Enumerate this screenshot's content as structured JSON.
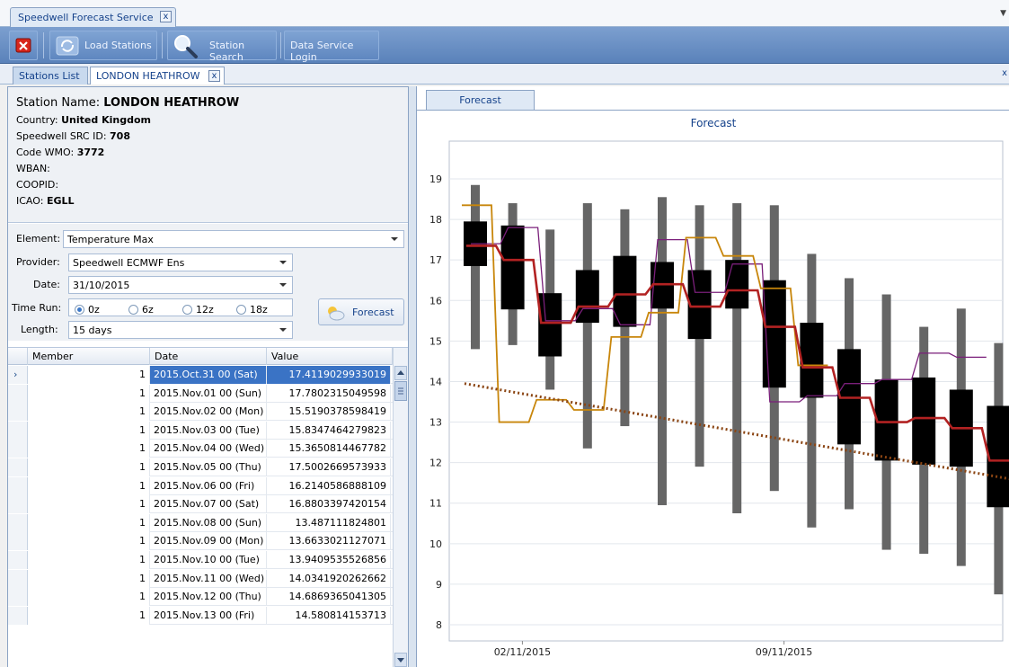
{
  "app": {
    "doc_tab": "Speedwell Forecast Service",
    "close_glyph": "x"
  },
  "toolbar": {
    "load_stations": "Load Stations",
    "station_search": "Station Search",
    "data_service_login": "Data Service Login"
  },
  "tabs": {
    "stations_list": "Stations List",
    "station_tab": "LONDON HEATHROW"
  },
  "station": {
    "name_label": "Station Name:",
    "name": "LONDON HEATHROW",
    "country_label": "Country:",
    "country": "United Kingdom",
    "src_label": "Speedwell SRC ID:",
    "src": "708",
    "wmo_label": "Code WMO:",
    "wmo": "3772",
    "wban_label": "WBAN:",
    "wban": "",
    "coopid_label": "COOPID:",
    "coopid": "",
    "icao_label": "ICAO:",
    "icao": "EGLL"
  },
  "controls": {
    "element_label": "Element:",
    "element_value": "Temperature Max",
    "provider_label": "Provider:",
    "provider_value": "Speedwell ECMWF Ens",
    "date_label": "Date:",
    "date_value": "31/10/2015",
    "time_run_label": "Time Run:",
    "time_runs": [
      "0z",
      "6z",
      "12z",
      "18z"
    ],
    "time_run_selected": "0z",
    "length_label": "Length:",
    "length_value": "15 days",
    "forecast_button": "Forecast"
  },
  "grid": {
    "columns": [
      "Member",
      "Date",
      "Value"
    ],
    "rows": [
      {
        "member": "1",
        "date": "2015.Oct.31 00 (Sat)",
        "value": "17.4119029933019"
      },
      {
        "member": "1",
        "date": "2015.Nov.01 00 (Sun)",
        "value": "17.7802315049598"
      },
      {
        "member": "1",
        "date": "2015.Nov.02 00 (Mon)",
        "value": "15.5190378598419"
      },
      {
        "member": "1",
        "date": "2015.Nov.03 00 (Tue)",
        "value": "15.8347464279823"
      },
      {
        "member": "1",
        "date": "2015.Nov.04 00 (Wed)",
        "value": "15.3650814467782"
      },
      {
        "member": "1",
        "date": "2015.Nov.05 00 (Thu)",
        "value": "17.5002669573933"
      },
      {
        "member": "1",
        "date": "2015.Nov.06 00 (Fri)",
        "value": "16.2140586888109"
      },
      {
        "member": "1",
        "date": "2015.Nov.07 00 (Sat)",
        "value": "16.8803397420154"
      },
      {
        "member": "1",
        "date": "2015.Nov.08 00 (Sun)",
        "value": "13.487111824801"
      },
      {
        "member": "1",
        "date": "2015.Nov.09 00 (Mon)",
        "value": "13.6633021127071"
      },
      {
        "member": "1",
        "date": "2015.Nov.10 00 (Tue)",
        "value": "13.9409535526856"
      },
      {
        "member": "1",
        "date": "2015.Nov.11 00 (Wed)",
        "value": "14.0341920262662"
      },
      {
        "member": "1",
        "date": "2015.Nov.12 00 (Thu)",
        "value": "14.6869365041305"
      },
      {
        "member": "1",
        "date": "2015.Nov.13 00 (Fri)",
        "value": "14.580814153713"
      }
    ]
  },
  "chart_tab": "Forecast",
  "colors": {
    "median": "#b22222",
    "member": "#c8860b",
    "member2": "#7a1f7a",
    "trend": "#8b4513",
    "box": "#000000",
    "whisker": "#666666"
  },
  "chart_data": {
    "type": "box",
    "title": "Forecast",
    "x_tick_labels": [
      "02/11/2015",
      "09/11/2015"
    ],
    "ylim": [
      8,
      19
    ],
    "y_ticks": [
      "8",
      "9",
      "10",
      "11",
      "12",
      "13",
      "14",
      "15",
      "16",
      "17",
      "18",
      "19"
    ],
    "grid": true,
    "boxes": [
      {
        "low": 14.8,
        "q1": 16.85,
        "q3": 17.95,
        "high": 18.85
      },
      {
        "low": 14.9,
        "q1": 15.78,
        "q3": 17.85,
        "high": 18.4
      },
      {
        "low": 13.8,
        "q1": 14.62,
        "q3": 16.18,
        "high": 17.75
      },
      {
        "low": 12.35,
        "q1": 15.45,
        "q3": 16.75,
        "high": 18.4
      },
      {
        "low": 12.9,
        "q1": 15.35,
        "q3": 17.1,
        "high": 18.25
      },
      {
        "low": 10.95,
        "q1": 15.8,
        "q3": 16.95,
        "high": 18.55
      },
      {
        "low": 11.9,
        "q1": 15.05,
        "q3": 16.75,
        "high": 18.35
      },
      {
        "low": 10.75,
        "q1": 15.8,
        "q3": 17.0,
        "high": 18.4
      },
      {
        "low": 11.3,
        "q1": 13.85,
        "q3": 16.5,
        "high": 18.35
      },
      {
        "low": 10.4,
        "q1": 13.6,
        "q3": 15.45,
        "high": 17.15
      },
      {
        "low": 10.85,
        "q1": 12.45,
        "q3": 14.8,
        "high": 16.55
      },
      {
        "low": 9.85,
        "q1": 12.05,
        "q3": 14.05,
        "high": 16.15
      },
      {
        "low": 9.75,
        "q1": 11.95,
        "q3": 14.1,
        "high": 15.35
      },
      {
        "low": 9.45,
        "q1": 11.9,
        "q3": 13.8,
        "high": 15.8
      },
      {
        "low": 8.75,
        "q1": 10.9,
        "q3": 13.4,
        "high": 14.95
      }
    ],
    "median": [
      17.35,
      17.0,
      15.45,
      15.85,
      16.15,
      16.4,
      15.85,
      16.25,
      15.35,
      14.35,
      13.6,
      13.0,
      13.1,
      12.85,
      12.05
    ],
    "member_orange": [
      18.35,
      13.0,
      13.55,
      13.3,
      15.1,
      15.7,
      17.55,
      17.1,
      16.3,
      14.4,
      null,
      null,
      null,
      null,
      null
    ],
    "member_purple": [
      17.4,
      17.8,
      15.5,
      15.8,
      15.4,
      17.5,
      16.2,
      16.9,
      13.5,
      13.65,
      13.95,
      14.05,
      14.7,
      14.6,
      null
    ],
    "trend": {
      "start": 13.95,
      "end": 11.6
    }
  }
}
